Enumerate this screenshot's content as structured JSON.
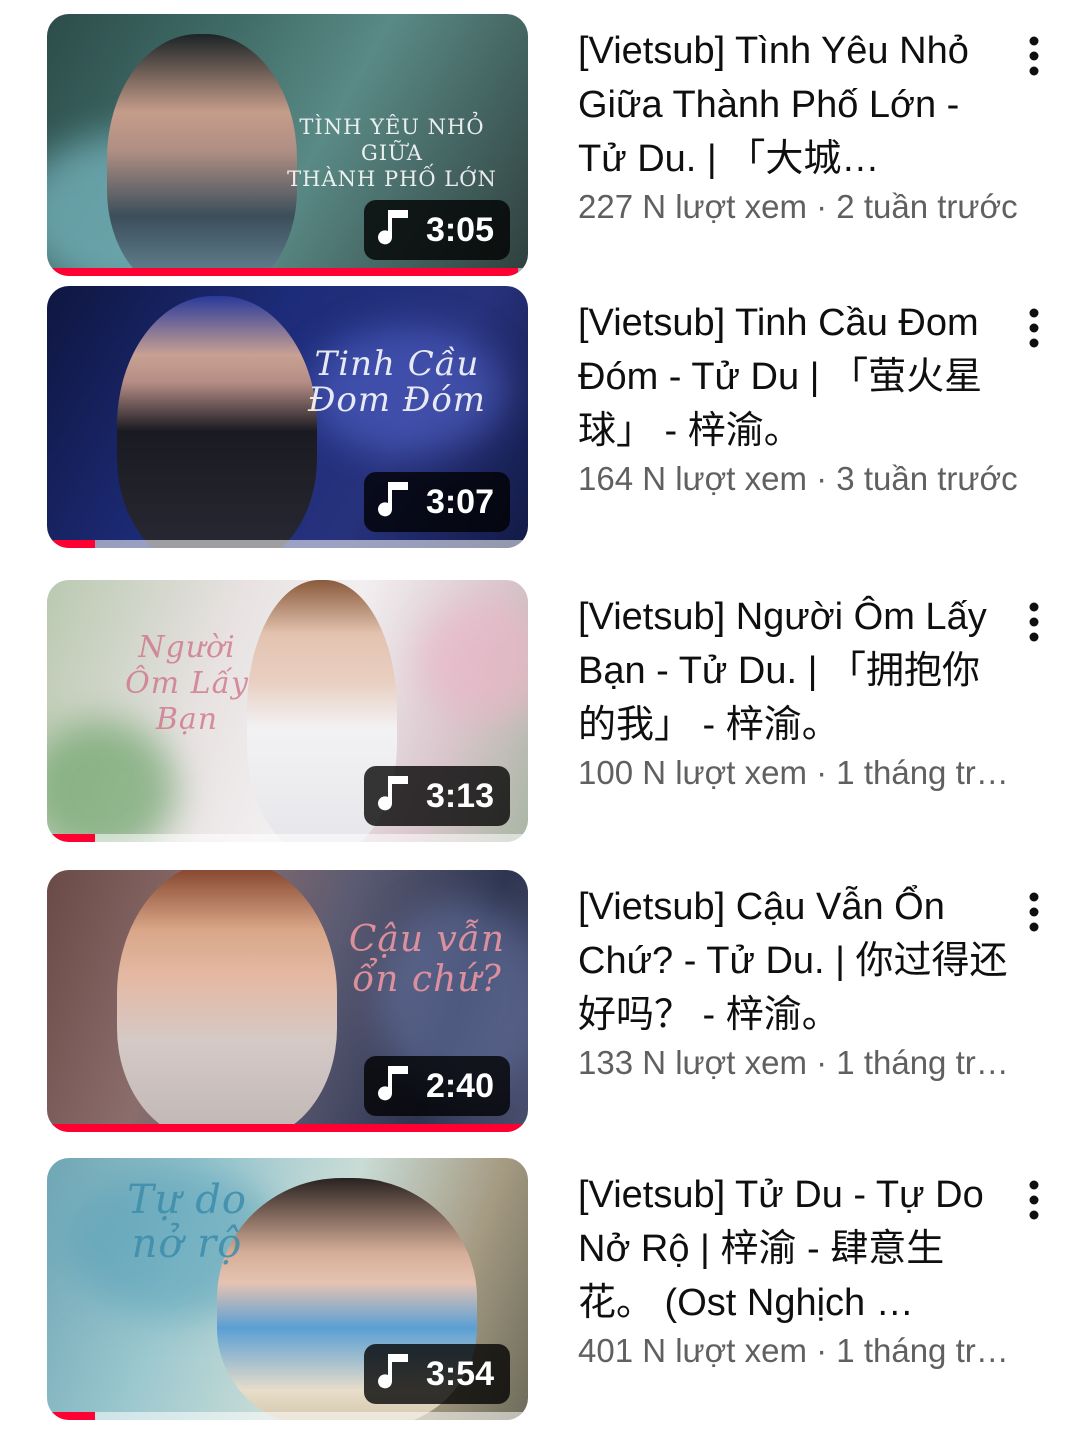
{
  "colors": {
    "progress": "#ff0033",
    "title": "#0f0f0f",
    "subtext": "#606060",
    "duration_bg": "#000000"
  },
  "videos": [
    {
      "title": "[Vietsub] Tình Yêu Nhỏ Giữa Thành Phố Lớn - Tử Du. | 「大城…",
      "stats": "227 N lượt xem · 2 tuần trước",
      "duration": "3:05",
      "progress": 0.98,
      "thumb_text": "TÌNH YÊU NHỎ GIỮA\nTHÀNH PHỐ LỚN"
    },
    {
      "title": "[Vietsub] Tinh Cầu Đom Đóm - Tử Du | 「萤火星球」 - 梓渝。",
      "stats": "164 N lượt xem · 3 tuần trước",
      "duration": "3:07",
      "progress": 0.1,
      "thumb_text": "Tinh Cầu\nĐom Đóm"
    },
    {
      "title": "[Vietsub] Người Ôm Lấy Bạn - Tử Du. | 「拥抱你的我」 - 梓渝。",
      "stats": "100 N lượt xem · 1 tháng tr…",
      "duration": "3:13",
      "progress": 0.1,
      "thumb_text": "Người\nÔm Lấy\nBạn"
    },
    {
      "title": "[Vietsub]  Cậu Vẫn Ổn Chứ? - Tử Du. | 你过得还好吗？ - 梓渝。",
      "stats": "133 N lượt xem · 1 tháng tr…",
      "duration": "2:40",
      "progress": 1.0,
      "thumb_text": "Cậu vẫn\nổn chứ?"
    },
    {
      "title": "[Vietsub] Tử Du - Tự Do Nở Rộ | 梓渝 - 肆意生花。 (Ost Nghịch …",
      "stats": "401 N lượt xem · 1 tháng tr…",
      "duration": "3:54",
      "progress": 0.1,
      "thumb_text": "Tự do\nnở rộ"
    }
  ]
}
